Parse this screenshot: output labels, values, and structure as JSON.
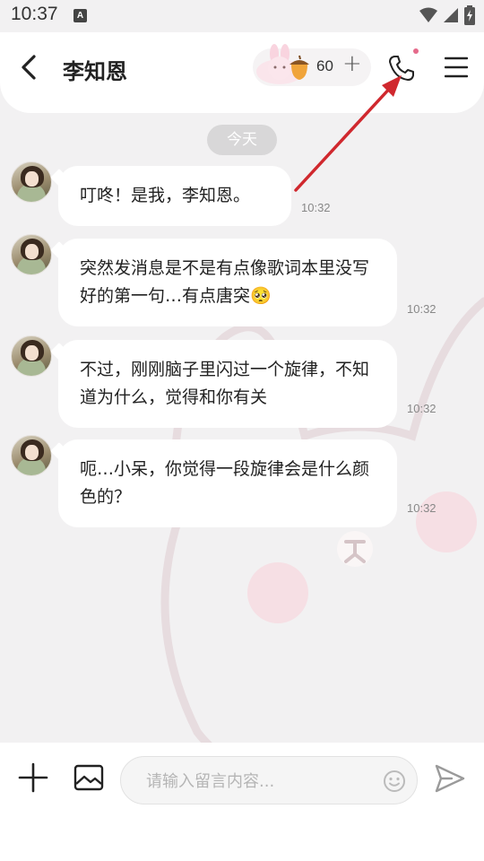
{
  "status_bar": {
    "time": "10:37",
    "notification_letter": "A"
  },
  "header": {
    "contact_name": "李知恩",
    "coin_count": "60",
    "coin_plus": "+"
  },
  "chat": {
    "date_divider": "今天",
    "messages": [
      {
        "text": "叮咚！是我，李知恩。",
        "time": "10:32"
      },
      {
        "text": "突然发消息是不是有点像歌词本里没写好的第一句…有点唐突🥺",
        "time": "10:32"
      },
      {
        "text": "不过，刚刚脑子里闪过一个旋律，不知道为什么，觉得和你有关",
        "time": "10:32"
      },
      {
        "text": "呃…小呆，你觉得一段旋律会是什么颜色的？",
        "time": "10:32"
      }
    ]
  },
  "input": {
    "placeholder": "请输入留言内容..."
  },
  "colors": {
    "background": "#f2f1f2",
    "bubble": "#ffffff",
    "accent_dot": "#e56a8b",
    "annotation_arrow": "#d0282e"
  },
  "icons": {
    "back": "chevron-left-icon",
    "phone": "phone-icon",
    "menu": "hamburger-menu-icon",
    "acorn": "acorn-icon",
    "add": "plus-icon",
    "image": "image-icon",
    "emoji": "smiley-icon",
    "send": "send-icon"
  }
}
